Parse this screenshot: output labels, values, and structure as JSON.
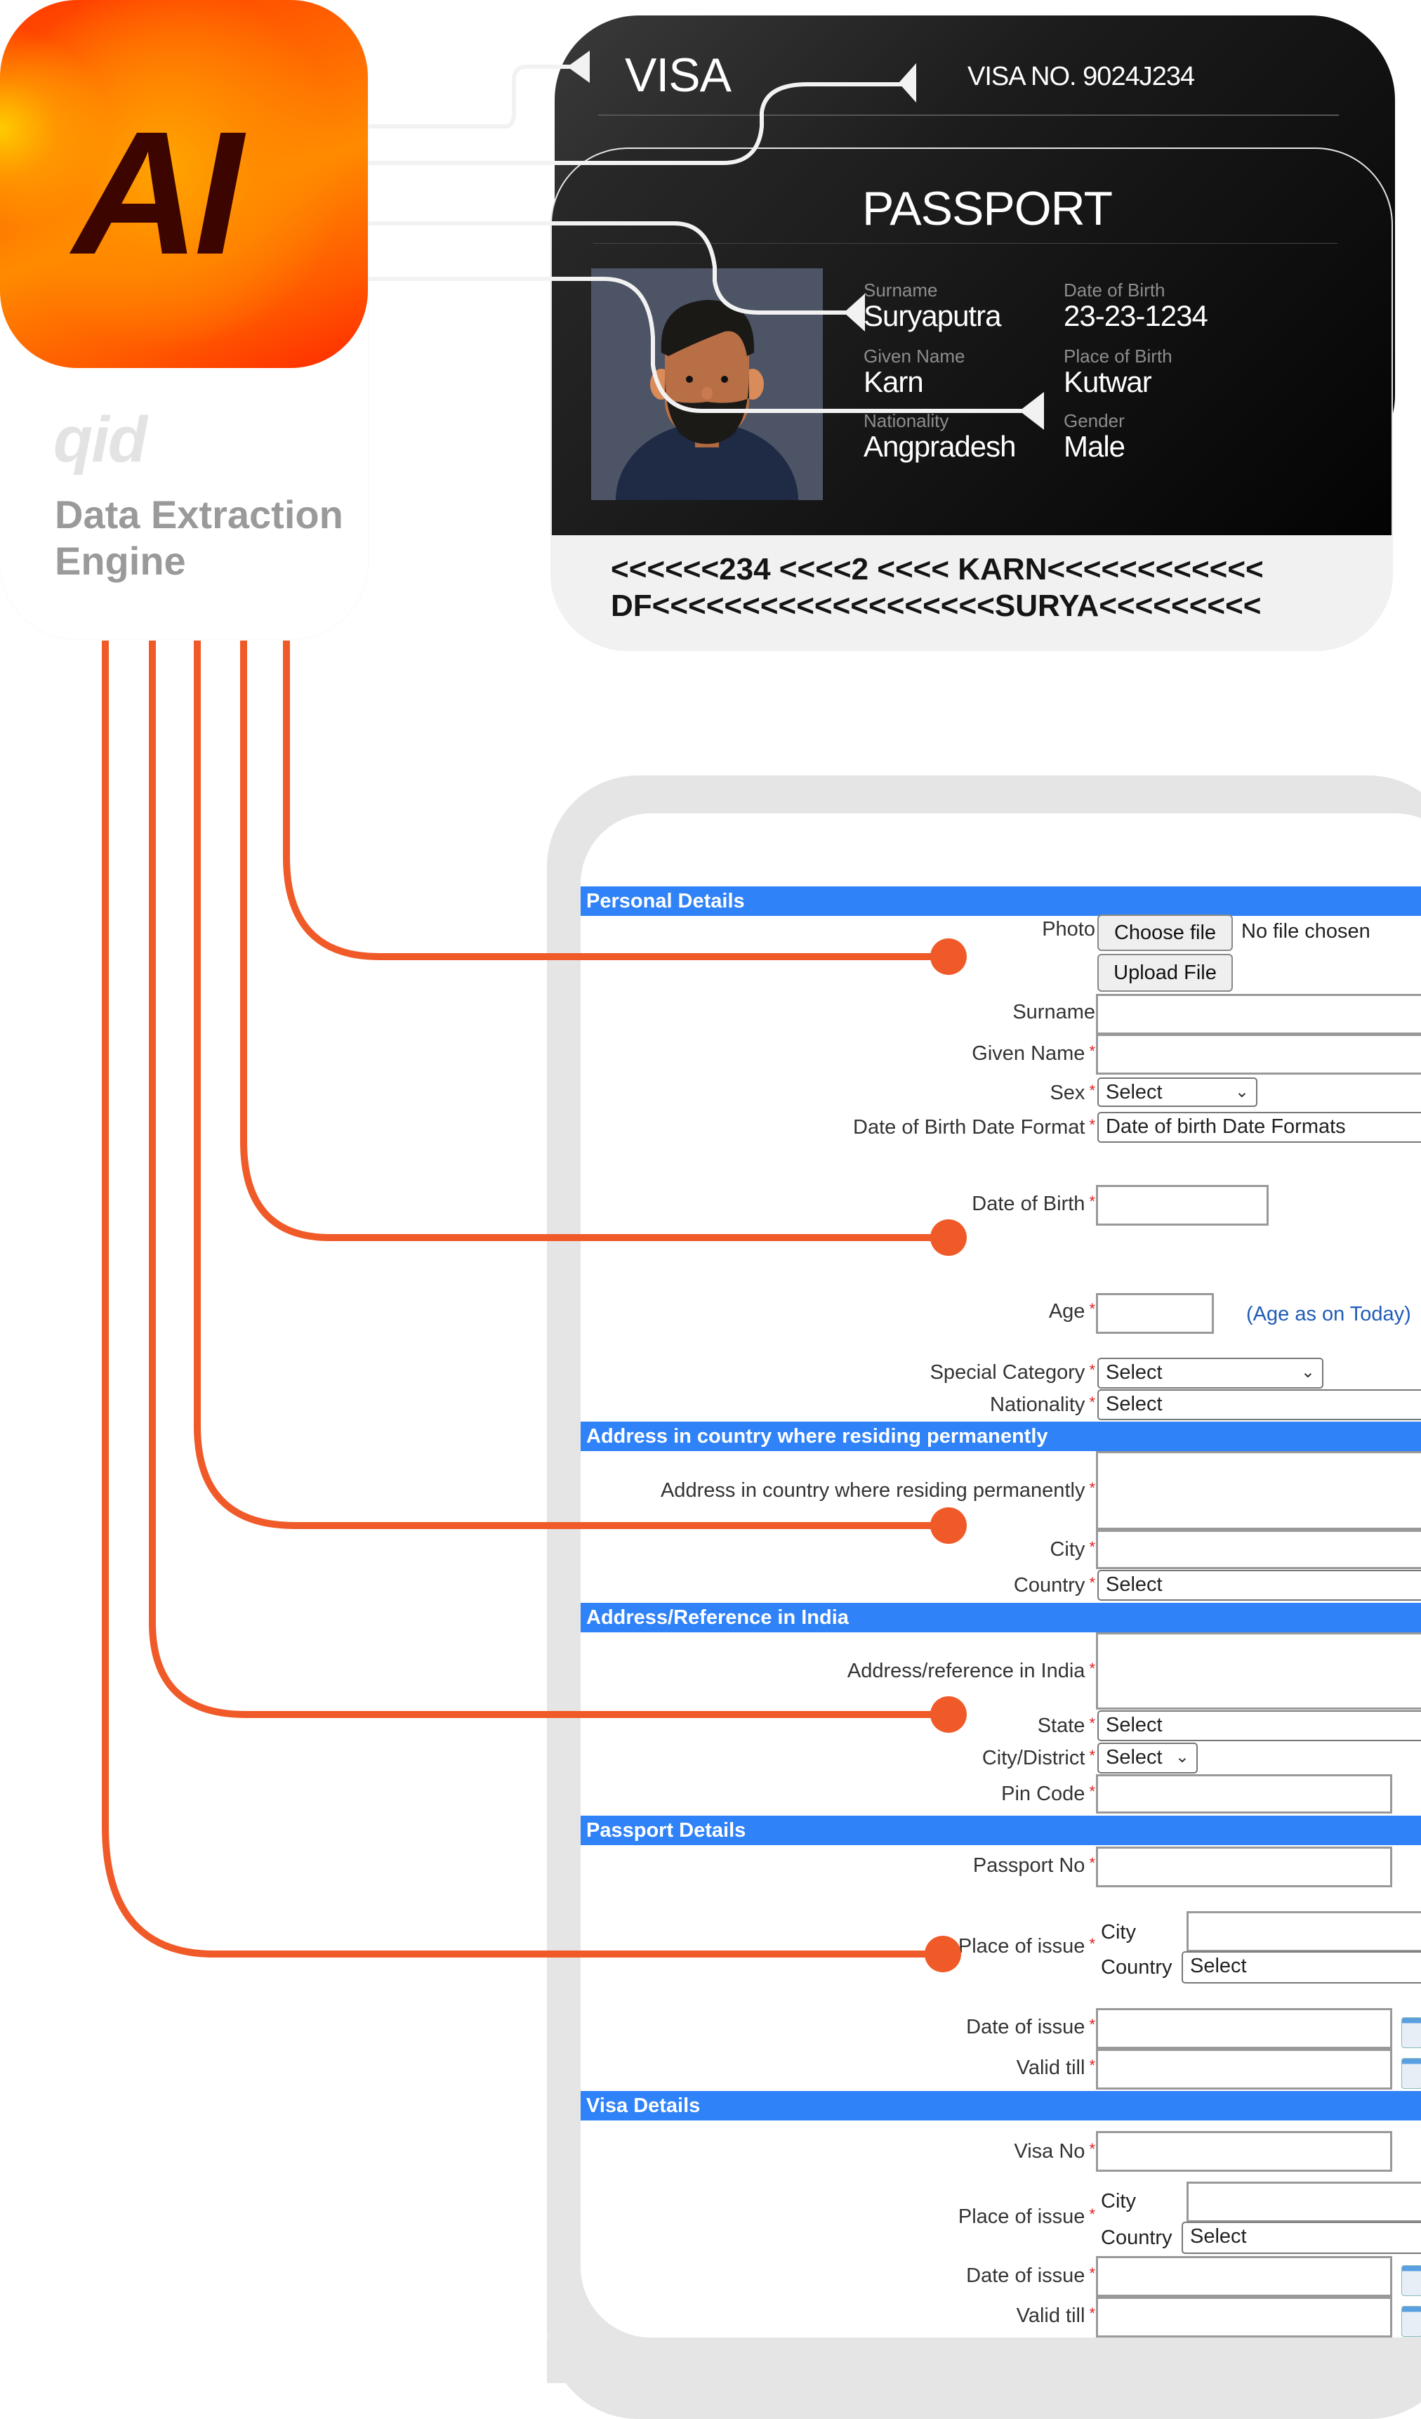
{
  "engine": {
    "logo_text": "AI",
    "brand": "qid",
    "title_line1": "Data Extraction",
    "title_line2": "Engine",
    "accent_color": "#f05a28",
    "logo_text_color": "#3d0500"
  },
  "visa_card": {
    "title": "VISA",
    "visa_no": "VISA NO. 9024J234"
  },
  "passport_card": {
    "title": "PASSPORT",
    "fields": [
      {
        "label": "Surname",
        "value": "Suryaputra"
      },
      {
        "label": "Date of Birth",
        "value": "23-23-1234"
      },
      {
        "label": "Given Name",
        "value": "Karn"
      },
      {
        "label": "Place of Birth",
        "value": "Kutwar"
      },
      {
        "label": "Nationality",
        "value": "Angpradesh"
      },
      {
        "label": "Gender",
        "value": "Male"
      }
    ],
    "mrz_line1": "<<<<<<234 <<<<2 <<<< KARN<<<<<<<<<<<<",
    "mrz_line2": "DF<<<<<<<<<<<<<<<<<<<SURYA<<<<<<<<<"
  },
  "form": {
    "required_mark": "*",
    "sections": {
      "personal": "Personal Details",
      "address_residing": "Address in country where residing permanently",
      "address_india": "Address/Reference in India",
      "passport": "Passport Details",
      "visa": "Visa Details"
    },
    "personal": {
      "photo_label": "Photo",
      "choose_file": "Choose file",
      "no_file": "No file chosen",
      "upload_file": "Upload File",
      "surname_label": "Surname",
      "given_name_label": "Given Name",
      "sex_label": "Sex",
      "sex_value": "Select",
      "dob_format_label": "Date of Birth Date Format",
      "dob_format_value": "Date of birth Date Formats",
      "dob_label": "Date of Birth",
      "age_label": "Age",
      "age_hint": "(Age as on Today)",
      "special_category_label": "Special Category",
      "special_category_value": "Select",
      "nationality_label": "Nationality",
      "nationality_value": "Select"
    },
    "address_residing": {
      "address_label": "Address in country where residing permanently",
      "city_label": "City",
      "country_label": "Country",
      "country_value": "Select"
    },
    "address_india": {
      "address_label": "Address/reference in India",
      "state_label": "State",
      "state_value": "Select",
      "district_label": "City/District",
      "district_value": "Select",
      "pin_label": "Pin Code"
    },
    "passport": {
      "passport_no_label": "Passport No",
      "place_label": "Place of issue",
      "city_label": "City",
      "country_label": "Country",
      "country_value": "Select",
      "date_issue_label": "Date of issue",
      "valid_till_label": "Valid till"
    },
    "visa": {
      "visa_no_label": "Visa No",
      "place_label": "Place of issue",
      "city_label": "City",
      "country_label": "Country",
      "country_value": "Select",
      "date_issue_label": "Date of issue",
      "valid_till_label": "Valid till"
    }
  }
}
